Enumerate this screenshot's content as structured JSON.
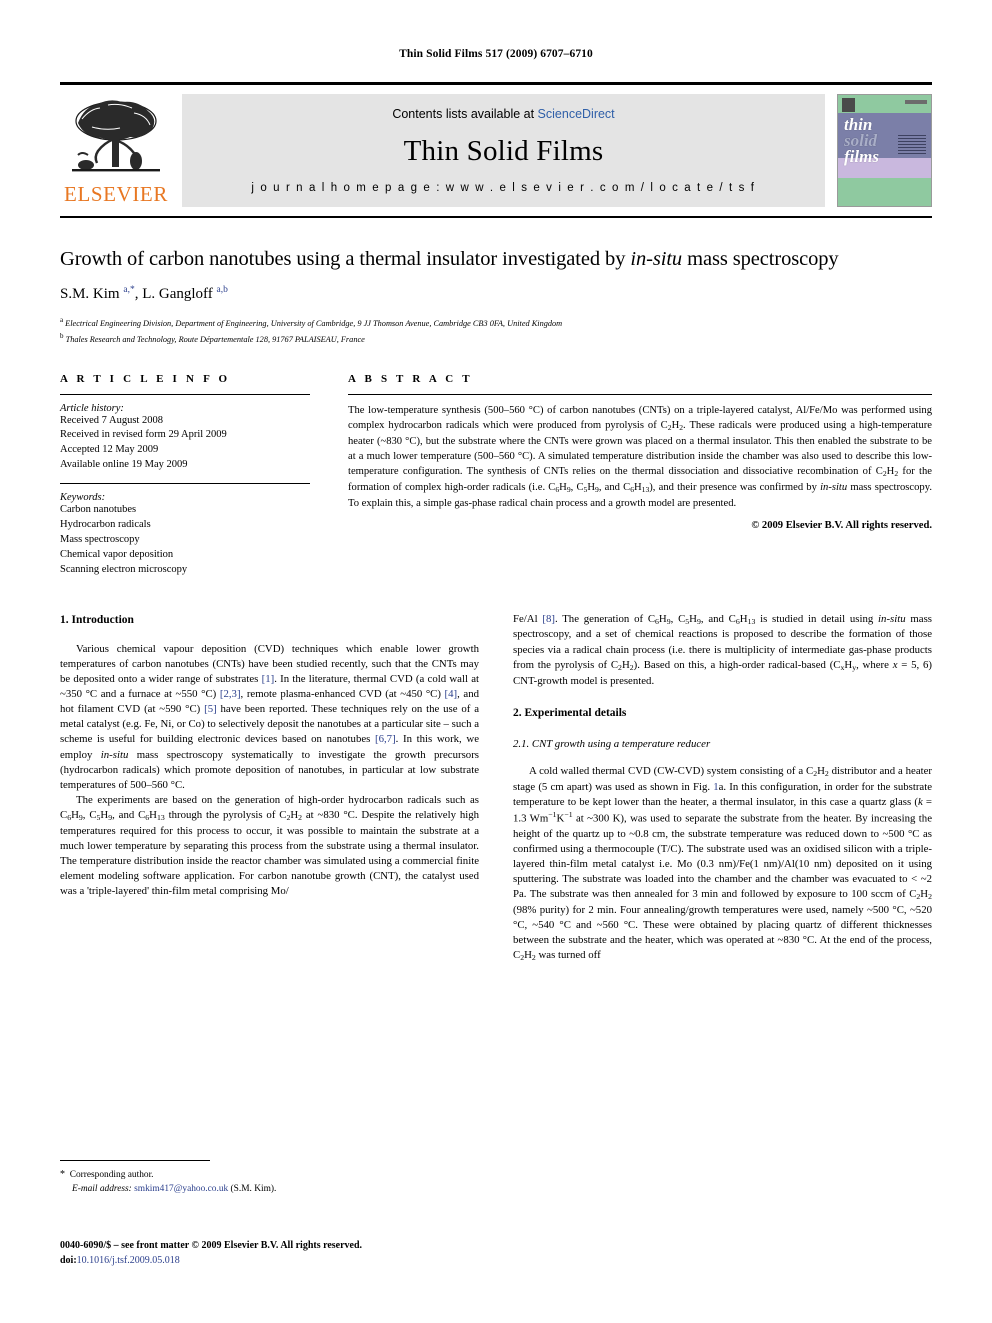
{
  "running_head": "Thin Solid Films 517 (2009) 6707–6710",
  "masthead": {
    "contents_prefix": "Contents lists available at ",
    "sciencedirect": "ScienceDirect",
    "journal_title": "Thin Solid Films",
    "homepage_label": "j o u r n a l   h o m e p a g e :   w w w . e l s e v i e r . c o m / l o c a t e / t s f",
    "publisher": "ELSEVIER",
    "cover_title_1": "thin",
    "cover_title_2": "solid",
    "cover_title_3": "films"
  },
  "article": {
    "title_part1": "Growth of carbon nanotubes using a thermal insulator investigated by ",
    "title_italic": "in-situ",
    "title_part2": " mass spectroscopy",
    "authors_plain1": "S.M. Kim ",
    "authors_sup1": "a,*",
    "authors_plain2": ", L. Gangloff ",
    "authors_sup2": "a,b",
    "affiliation_a_marker": "a",
    "affiliation_a": " Electrical Engineering Division, Department of Engineering, University of Cambridge, 9 JJ Thomson Avenue, Cambridge CB3 0FA, United Kingdom",
    "affiliation_b_marker": "b",
    "affiliation_b": " Thales Research and Technology, Route Départementale 128, 91767 PALAISEAU, France"
  },
  "article_info": {
    "heading": "A R T I C L E   I N F O",
    "history_label": "Article history:",
    "history": [
      "Received 7 August 2008",
      "Received in revised form 29 April 2009",
      "Accepted 12 May 2009",
      "Available online 19 May 2009"
    ],
    "keywords_label": "Keywords:",
    "keywords": [
      "Carbon nanotubes",
      "Hydrocarbon radicals",
      "Mass spectroscopy",
      "Chemical vapor deposition",
      "Scanning electron microscopy"
    ]
  },
  "abstract": {
    "heading": "A B S T R A C T",
    "text_1": "The low-temperature synthesis (500–560 °C) of carbon nanotubes (CNTs) on a triple-layered catalyst, Al/Fe/Mo was performed using complex hydrocarbon radicals which were produced from pyrolysis of C",
    "text_2": ". These radicals were produced using a high-temperature heater (~830 °C), but the substrate where the CNTs were grown was placed on a thermal insulator. This then enabled the substrate to be at a much lower temperature (500–560 °C). A simulated temperature distribution inside the chamber was also used to describe this low-temperature configuration. The synthesis of CNTs relies on the thermal dissociation and dissociative recombination of C",
    "text_3": " for the formation of complex high-order radicals (i.e. C",
    "text_4": ", C",
    "text_5": ", and C",
    "text_6": "), and their presence was confirmed by ",
    "text_7": "in-situ",
    "text_8": " mass spectroscopy. To explain this, a simple gas-phase radical chain process and a growth model are presented.",
    "copyright": "© 2009 Elsevier B.V. All rights reserved."
  },
  "sections": {
    "intro_heading": "1. Introduction",
    "intro_p1_a": "Various chemical vapour deposition (CVD) techniques which enable lower growth temperatures of carbon nanotubes (CNTs) have been studied recently, such that the CNTs may be deposited onto a wider range of substrates ",
    "intro_p1_c1": "[1]",
    "intro_p1_b": ". In the literature, thermal CVD (a cold wall at ~350 °C and a furnace at ~550 °C) ",
    "intro_p1_c2": "[2,3]",
    "intro_p1_c": ", remote plasma-enhanced CVD (at ~450 °C) ",
    "intro_p1_c3": "[4]",
    "intro_p1_d": ", and hot filament CVD (at ~590 °C) ",
    "intro_p1_c4": "[5]",
    "intro_p1_e": " have been reported. These techniques rely on the use of a metal catalyst (e.g. Fe, Ni, or Co) to selectively deposit the nanotubes at a particular site – such a scheme is useful for building electronic devices based on nanotubes ",
    "intro_p1_c5": "[6,7]",
    "intro_p1_f": ". In this work, we employ ",
    "intro_p1_it": "in-situ",
    "intro_p1_g": " mass spectroscopy systematically to investigate the growth precursors (hydrocarbon radicals) which promote deposition of nanotubes, in particular at low substrate temperatures of 500–560 °C.",
    "intro_p2_a": "The experiments are based on the generation of high-order hydrocarbon radicals such as C",
    "intro_p2_b": ", C",
    "intro_p2_c": ", and C",
    "intro_p2_d": " through the pyrolysis of C",
    "intro_p2_e": " at ~830 °C. Despite the relatively high temperatures required for this process to occur, it was possible to maintain the substrate at a much lower temperature by separating this process from the substrate using a thermal insulator. The temperature distribution inside the reactor chamber was simulated using a commercial finite element modeling software application. For carbon nanotube growth (CNT), the catalyst used was a 'triple-layered' thin-film metal comprising Mo/",
    "right_p1_a": "Fe/Al ",
    "right_p1_c1": "[8]",
    "right_p1_b": ". The generation of C",
    "right_p1_c": ", C",
    "right_p1_d": ", and C",
    "right_p1_e": " is studied in detail using ",
    "right_p1_it": "in-situ",
    "right_p1_f": " mass spectroscopy, and a set of chemical reactions is proposed to describe the formation of those species via a radical chain process (i.e. there is multiplicity of intermediate gas-phase products from the pyrolysis of C",
    "right_p1_g": "). Based on this, a high-order radical-based (C",
    "right_p1_h": "H",
    "right_p1_i": ", where ",
    "right_p1_x": "x",
    "right_p1_j": " = 5, 6) CNT-growth model is presented.",
    "exp_heading": "2. Experimental details",
    "exp_subheading": "2.1. CNT growth using a temperature reducer",
    "exp_p1_a": "A cold walled thermal CVD (CW-CVD) system consisting of a C",
    "exp_p1_b": " distributor and a heater stage (5 cm apart) was used as shown in Fig. ",
    "exp_p1_fig": "1",
    "exp_p1_c": "a. In this configuration, in order for the substrate temperature to be kept lower than the heater, a thermal insulator, in this case a quartz glass (",
    "exp_p1_k": "k",
    "exp_p1_d": " = 1.3 Wm",
    "exp_p1_e": "K",
    "exp_p1_f": " at ~300 K), was used to separate the substrate from the heater. By increasing the height of the quartz up to ~0.8 cm, the substrate temperature was reduced down to ~500 °C as confirmed using a thermocouple (T/C). The substrate used was an oxidised silicon with a triple-layered thin-film metal catalyst i.e. Mo (0.3 nm)/Fe(1 nm)/Al(10 nm) deposited on it using sputtering. The substrate was loaded into the chamber and the chamber was evacuated to < ~2 Pa. The substrate was then annealed for 3 min and followed by exposure to 100 sccm of C",
    "exp_p1_g": " (98% purity) for 2 min. Four annealing/growth temperatures were used, namely ~500 °C, ~520 °C, ~540 °C and ~560 °C. These were obtained by placing quartz of different thicknesses between the substrate and the heater, which was operated at ~830 °C. At the end of the process, C",
    "exp_p1_h": " was turned off"
  },
  "footnotes": {
    "corresponding": "Corresponding author.",
    "email_label": "E-mail address:",
    "email": "smkim417@yahoo.co.uk",
    "email_owner": " (S.M. Kim).",
    "imprint_line": "0040-6090/$ – see front matter © 2009 Elsevier B.V. All rights reserved.",
    "doi_label": "doi:",
    "doi": "10.1016/j.tsf.2009.05.018"
  },
  "formulas": {
    "c2h2_sub1": "2",
    "c2h2_sub2": "2",
    "c6h9_a": "6",
    "c6h9_b": "9",
    "c5h9_a": "5",
    "c5h9_b": "9",
    "c6h13_a": "6",
    "c6h13_b": "13",
    "neg1_a": "−1",
    "neg1_b": "−1",
    "sub_x": "x",
    "sub_y": "y"
  },
  "colors": {
    "link": "#2b3f8c",
    "elsevier_orange": "#E87722",
    "sciencedirect_blue": "#2f5fa8",
    "band_grey": "#e4e4e4"
  }
}
